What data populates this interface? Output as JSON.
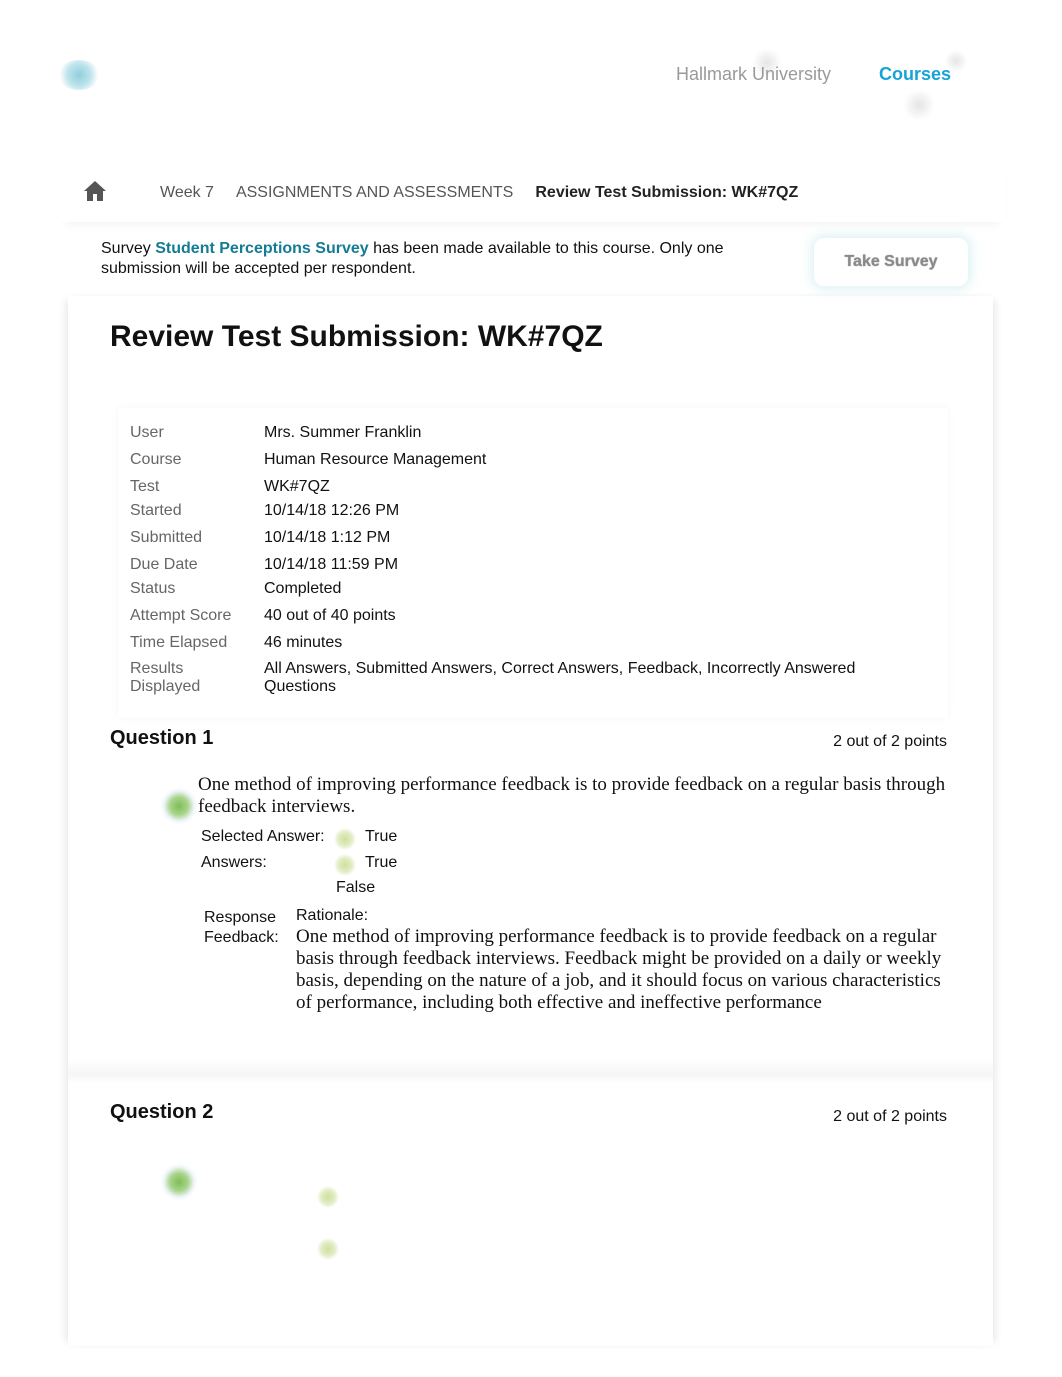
{
  "header": {
    "logo_icon": "university-logo-icon",
    "school_name": "Hallmark University",
    "courses_link": "Courses"
  },
  "breadcrumb": {
    "home_icon": "home-icon",
    "items": [
      "Week 7",
      "ASSIGNMENTS AND ASSESSMENTS",
      "Review Test Submission: WK#7QZ"
    ]
  },
  "notice": {
    "prefix": "Survey ",
    "survey_link": "Student Perceptions Survey",
    "suffix": " has been made available to this course. Only one submission will be accepted per respondent.",
    "button_label": "Take Survey"
  },
  "page": {
    "title": "Review Test Submission: WK#7QZ"
  },
  "details": [
    {
      "label": "User",
      "value": "Mrs. Summer Franklin"
    },
    {
      "label": "Course",
      "value": "Human Resource Management"
    },
    {
      "label": "Test",
      "value": "WK#7QZ"
    },
    {
      "label": "Started",
      "value": "10/14/18 12:26 PM"
    },
    {
      "label": "Submitted",
      "value": "10/14/18 1:12 PM"
    },
    {
      "label": "Due Date",
      "value": "10/14/18 11:59 PM"
    },
    {
      "label": "Status",
      "value": "Completed"
    },
    {
      "label": "Attempt Score",
      "value": "40 out of 40 points"
    },
    {
      "label": "Time Elapsed",
      "value": "46 minutes"
    },
    {
      "label": "Results Displayed",
      "value": "All Answers, Submitted Answers, Correct Answers, Feedback, Incorrectly Answered Questions"
    }
  ],
  "questions": [
    {
      "title": "Question 1",
      "points": "2 out of 2 points",
      "status_icon": "correct-check-icon",
      "text": "One method of improving performance feedback is to provide feedback on a regular basis through feedback interviews.",
      "selected_answer_label": "Selected Answer:",
      "selected_answer": "True",
      "answers_label": "Answers:",
      "answers": [
        "True",
        "False"
      ],
      "feedback_label": "Response Feedback:",
      "feedback_title": "Rationale:",
      "feedback_text": "One method of improving performance feedback is to provide feedback on a regular basis through feedback interviews. Feedback might be provided on a daily or weekly basis, depending on the nature of a job, and it should focus on various characteristics of performance, including both effective and ineffective performance"
    },
    {
      "title": "Question 2",
      "points": "2 out of 2 points",
      "status_icon": "correct-check-icon"
    }
  ]
}
